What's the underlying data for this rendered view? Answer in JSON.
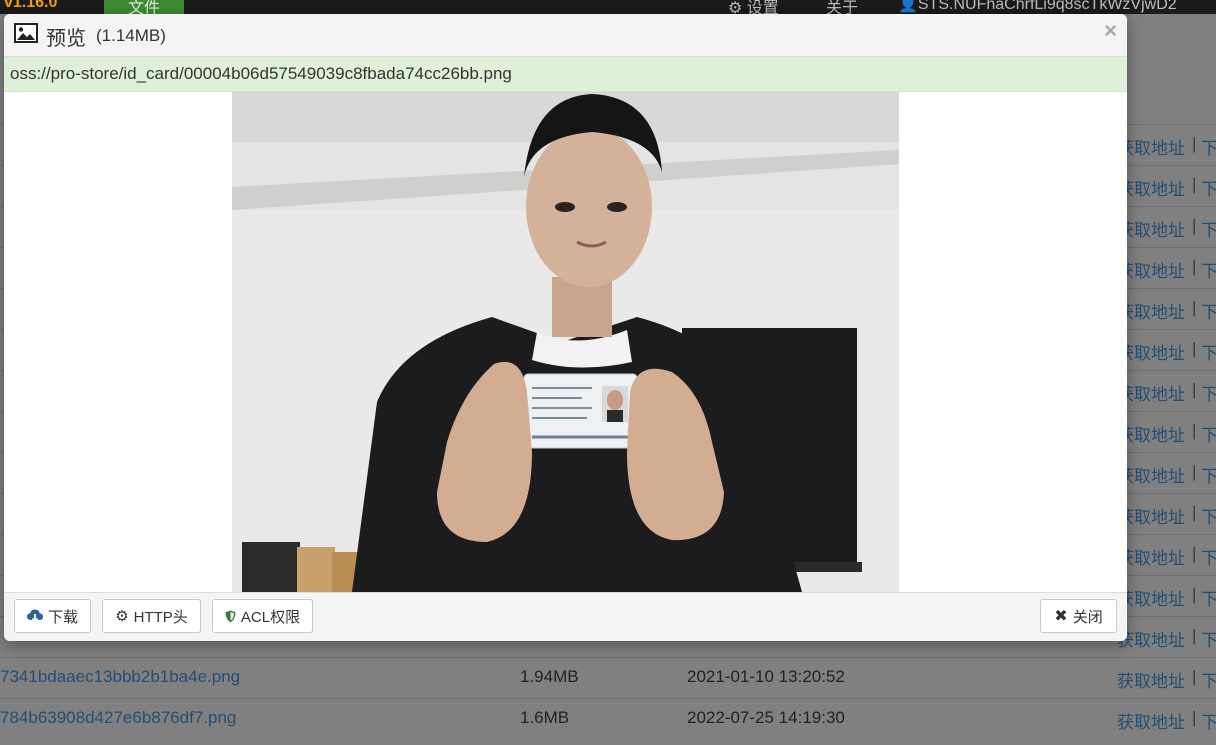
{
  "topbar": {
    "version": "v1.16.0",
    "files_tab": "文件",
    "settings": "设置",
    "about": "关于",
    "user": "STS.NUFhaChrfLi9q8scTkWzVjwD2"
  },
  "background_rows": [
    {
      "name": "",
      "size": "",
      "date": "",
      "action": "获取地址",
      "sep": "|",
      "more": "下"
    },
    {
      "name": "",
      "size": "",
      "date": "",
      "action": "获取地址",
      "sep": "|",
      "more": "下"
    },
    {
      "name": "",
      "size": "",
      "date": "",
      "action": "获取地址",
      "sep": "|",
      "more": "下"
    },
    {
      "name": "",
      "size": "",
      "date": "",
      "action": "获取地址",
      "sep": "|",
      "more": "下"
    },
    {
      "name": "",
      "size": "",
      "date": "",
      "action": "获取地址",
      "sep": "|",
      "more": "下"
    },
    {
      "name": "",
      "size": "",
      "date": "",
      "action": "获取地址",
      "sep": "|",
      "more": "下"
    },
    {
      "name": "",
      "size": "",
      "date": "",
      "action": "获取地址",
      "sep": "|",
      "more": "下"
    },
    {
      "name": "",
      "size": "",
      "date": "",
      "action": "获取地址",
      "sep": "|",
      "more": "下"
    },
    {
      "name": "",
      "size": "",
      "date": "",
      "action": "获取地址",
      "sep": "|",
      "more": "下"
    },
    {
      "name": "",
      "size": "",
      "date": "",
      "action": "获取地址",
      "sep": "|",
      "more": "下"
    },
    {
      "name": "",
      "size": "",
      "date": "",
      "action": "获取地址",
      "sep": "|",
      "more": "下"
    },
    {
      "name": "",
      "size": "",
      "date": "",
      "action": "获取地址",
      "sep": "|",
      "more": "下"
    },
    {
      "name": "",
      "size": "",
      "date": "",
      "action": "获取地址",
      "sep": "|",
      "more": "下"
    },
    {
      "name": "7341bdaaec13bbb2b1ba4e.png",
      "size": "1.94MB",
      "date": "2021-01-10 13:20:52",
      "action": "获取地址",
      "sep": "|",
      "more": "下"
    },
    {
      "name": "784b63908d427e6b876df7.png",
      "size": "1.6MB",
      "date": "2022-07-25 14:19:30",
      "action": "获取地址",
      "sep": "|",
      "more": "下"
    }
  ],
  "modal": {
    "title": "预览",
    "size": "(1.14MB)",
    "close_symbol": "×",
    "path": "oss://pro-store/id_card/00004b06d57549039c8fbada74cc26bb.png",
    "buttons": {
      "download": "下载",
      "http_headers": "HTTP头",
      "acl": "ACL权限",
      "close": "关闭"
    }
  },
  "colors": {
    "path_bar_bg": "#dff0d8",
    "link_blue": "#2a6496",
    "version_orange": "#f0a30a",
    "files_tab_green": "#3c8c32"
  }
}
